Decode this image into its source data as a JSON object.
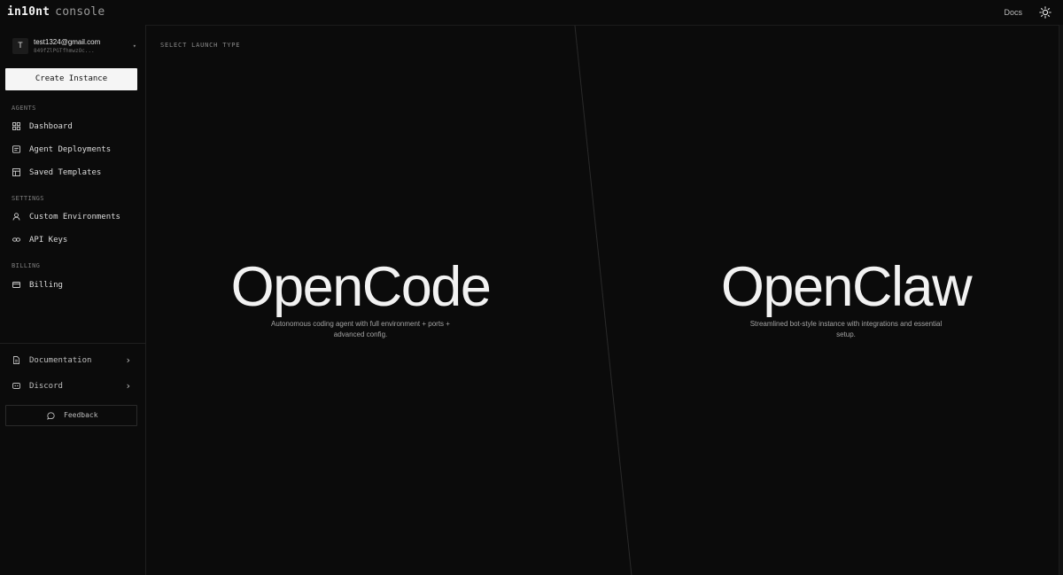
{
  "brand": {
    "name": "in10nt",
    "suffix": "console"
  },
  "topbar": {
    "docs_label": "Docs",
    "theme_icon": "sun-icon"
  },
  "account": {
    "avatar_initial": "T",
    "email": "test1324@gmail.com",
    "id": "849fZlPGTfhmwzOc...",
    "caret": "▾"
  },
  "sidebar": {
    "create_label": "Create Instance",
    "sections": {
      "agents": "AGENTS",
      "settings": "SETTINGS",
      "billing": "BILLING"
    },
    "items": [
      {
        "label": "Dashboard",
        "icon": "grid-icon"
      },
      {
        "label": "Agent Deployments",
        "icon": "list-icon"
      },
      {
        "label": "Saved Templates",
        "icon": "template-icon"
      },
      {
        "label": "Custom Environments",
        "icon": "user-icon"
      },
      {
        "label": "API Keys",
        "icon": "key-icon"
      },
      {
        "label": "Billing",
        "icon": "card-icon"
      }
    ],
    "external": [
      {
        "label": "Documentation",
        "icon": "document-icon",
        "chevron": "›"
      },
      {
        "label": "Discord",
        "icon": "discord-icon",
        "chevron": "›"
      }
    ],
    "feedback_label": "Feedback"
  },
  "main": {
    "launch_label": "SELECT LAUNCH TYPE",
    "options": [
      {
        "title": "OpenCode",
        "description": "Autonomous coding agent with full environment + ports + advanced config."
      },
      {
        "title": "OpenClaw",
        "description": "Streamlined bot-style instance with integrations and essential setup."
      }
    ]
  },
  "colors": {
    "background": "#0b0b0b",
    "text": "#e6e6e6",
    "muted": "#8a8a8a",
    "button_bg": "#f5f5f5"
  }
}
